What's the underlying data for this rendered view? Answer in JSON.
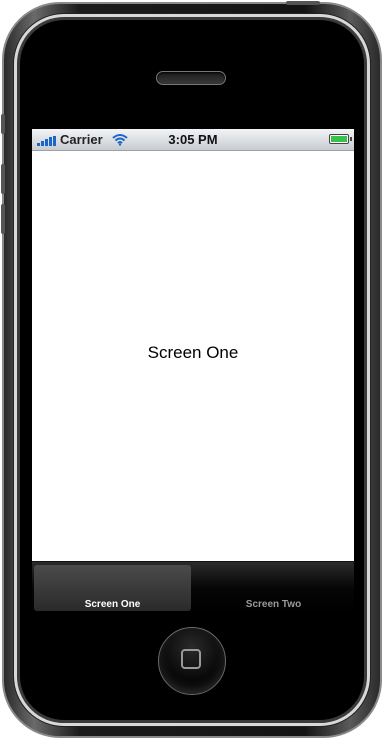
{
  "status_bar": {
    "carrier": "Carrier",
    "time": "3:05 PM",
    "signal_icon": "signal-bars-icon",
    "wifi_icon": "wifi-icon",
    "battery_icon": "battery-icon",
    "battery_level": 1.0
  },
  "screen": {
    "label": "Screen One"
  },
  "tab_bar": {
    "tabs": [
      {
        "label": "Screen One",
        "selected": true
      },
      {
        "label": "Screen Two",
        "selected": false
      }
    ]
  },
  "colors": {
    "signal": "#1b66c9",
    "wifi": "#1b66c9",
    "battery": "#35c34a"
  }
}
